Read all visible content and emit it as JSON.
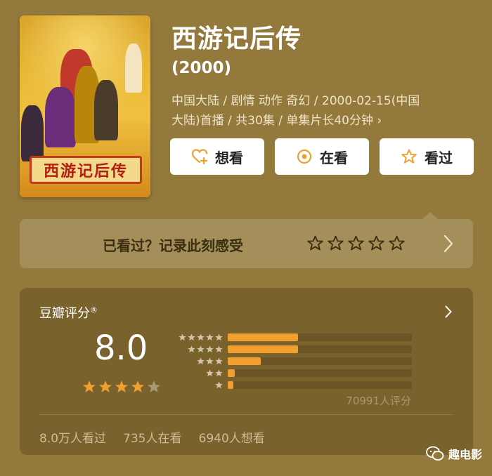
{
  "movie": {
    "title": "西游记后传",
    "year": "(2000)",
    "meta_line1": "中国大陆 / 剧情 动作 奇幻 / 2000-02-15(中国",
    "meta_line2": "大陆)首播 / 共30集 / 单集片长40分钟 ›",
    "poster_text": "西游记后传"
  },
  "actions": {
    "want_label": "想看",
    "watching_label": "在看",
    "watched_label": "看过"
  },
  "record": {
    "label": "已看过？记录此刻感受",
    "star_count": 5
  },
  "rating": {
    "title": "豆瓣评分",
    "title_mark": "®",
    "score": "8.0",
    "stars_filled": 4,
    "stars_total": 5,
    "distribution": [
      {
        "stars": 5,
        "fraction": 0.38
      },
      {
        "stars": 4,
        "fraction": 0.38
      },
      {
        "stars": 3,
        "fraction": 0.18
      },
      {
        "stars": 2,
        "fraction": 0.04
      },
      {
        "stars": 1,
        "fraction": 0.03
      }
    ],
    "count": "70991人评分",
    "watched": "8.0万人看过",
    "watching": "735人在看",
    "want": "6940人想看"
  },
  "watermark": {
    "text": "趣电影"
  },
  "colors": {
    "background": "#93793b",
    "accent": "#f1a030",
    "star_empty": "#a99a78"
  }
}
